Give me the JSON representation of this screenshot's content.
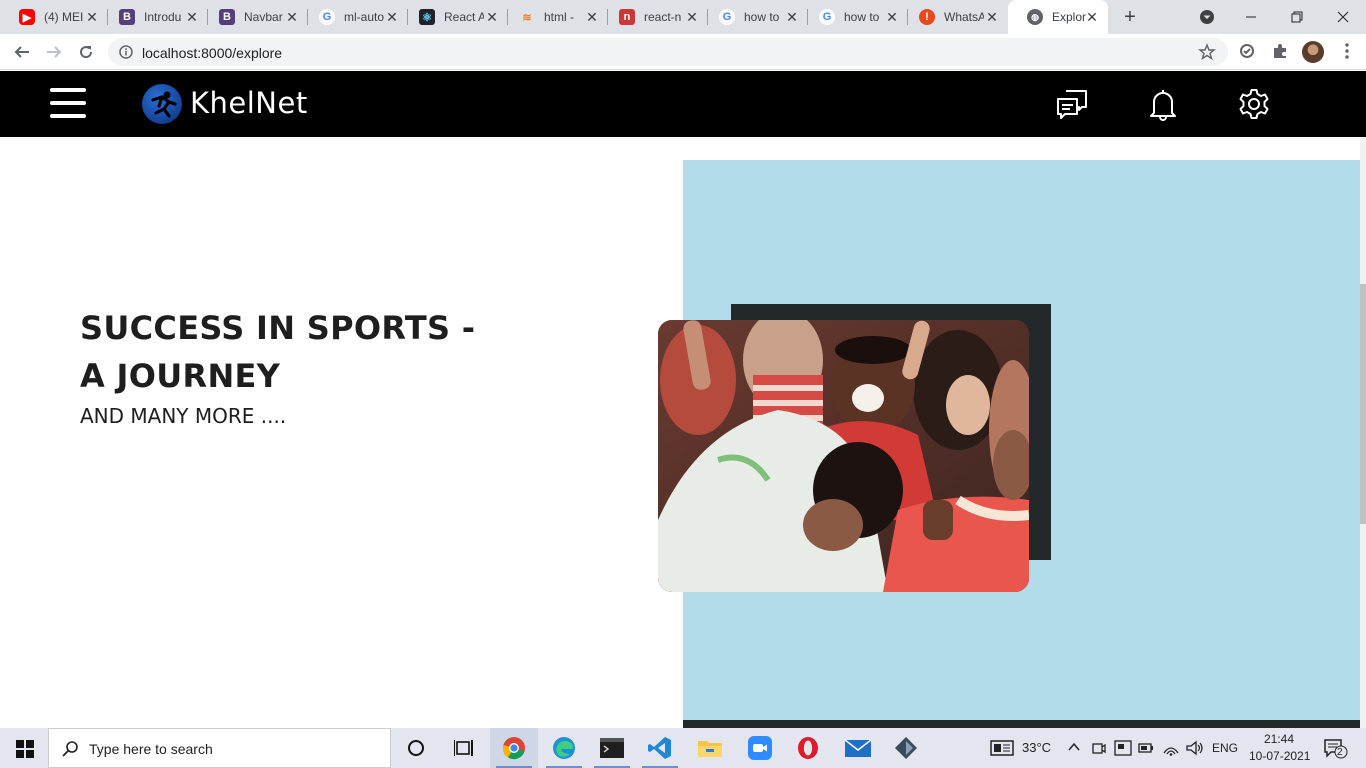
{
  "browser": {
    "tabs": [
      {
        "title": "(4) MEI",
        "favicon": "youtube-icon",
        "color": "#ff0000"
      },
      {
        "title": "Introdu",
        "favicon": "bootstrap-icon",
        "color": "#563d7c"
      },
      {
        "title": "Navbar",
        "favicon": "bootstrap-icon",
        "color": "#563d7c"
      },
      {
        "title": "ml-auto",
        "favicon": "google-icon",
        "color": "#4285f4"
      },
      {
        "title": "React A",
        "favicon": "react-icon",
        "color": "#20232a"
      },
      {
        "title": "html - ",
        "favicon": "stackoverflow-icon",
        "color": "#f48024"
      },
      {
        "title": "react-n",
        "favicon": "npm-icon",
        "color": "#cb3837"
      },
      {
        "title": "how to",
        "favicon": "google-icon",
        "color": "#4285f4"
      },
      {
        "title": "how to",
        "favicon": "google-icon",
        "color": "#4285f4"
      },
      {
        "title": "WhatsA",
        "favicon": "warning-icon",
        "color": "#e8491d"
      },
      {
        "title": "Explore",
        "favicon": "globe-icon",
        "color": "#5f6368"
      }
    ],
    "url": "localhost:8000/explore"
  },
  "site": {
    "brand": "KhelNet",
    "hero_title": "SUCCESS IN SPORTS - A JOURNEY",
    "hero_subtitle": "AND MANY MORE ....",
    "colors": {
      "navbar": "#000000",
      "hero_panel": "#b3dcea",
      "photo_frame": "#23292b"
    }
  },
  "taskbar": {
    "search_placeholder": "Type here to search",
    "weather": "33°C",
    "language": "ENG",
    "time": "21:44",
    "date": "10-07-2021",
    "notifications": "2"
  }
}
